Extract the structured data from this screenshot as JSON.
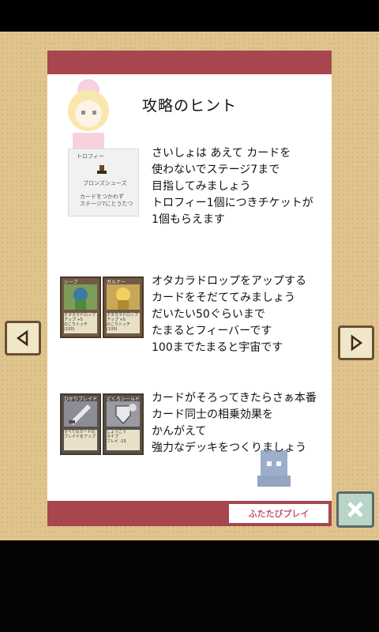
{
  "title": "攻略のヒント",
  "tips": [
    {
      "text": "さいしょは あえて カードを\n使わないでステージ7まで\n目指してみましょう\nトロフィー1個につきチケットが\n1個もらえます"
    },
    {
      "text": "オタカラドロップをアップする\nカードをそだててみましょう\nだいたい50ぐらいまで\nたまるとフィーバーです\n100までたまると宇宙です"
    },
    {
      "text": "カードがそろってきたらさぁ本番\nカード同士の相乗効果を\nかんがえて\n強力なデッキをつくりましょう"
    }
  ],
  "trophy": {
    "label": "トロフィー",
    "name": "ブロンズシューズ",
    "desc": "カードをつかわず\nステージ7にとうたつ"
  },
  "cards": [
    {
      "name": "シーフ",
      "text": "オタカラドロップ の\nアップ +5\nのこりトッチ\n(100)"
    },
    {
      "name": "ガルナー",
      "text": "オタカラドロップ の\nアップ +5\nのこりトッチ\n(100)"
    },
    {
      "name": "ひかりブレイド",
      "text": "すべてのカードの\nブレイドをアップ"
    },
    {
      "name": "どくろシールド",
      "text": "しょうこう\nタイプ\nブレイ -15"
    }
  ],
  "replay_label": "ふたたびプレイ",
  "icons": {
    "prev": "left-arrow-icon",
    "next": "right-arrow-icon",
    "close": "close-icon"
  },
  "colors": {
    "accent": "#a84650",
    "board": "#e0c48e"
  }
}
